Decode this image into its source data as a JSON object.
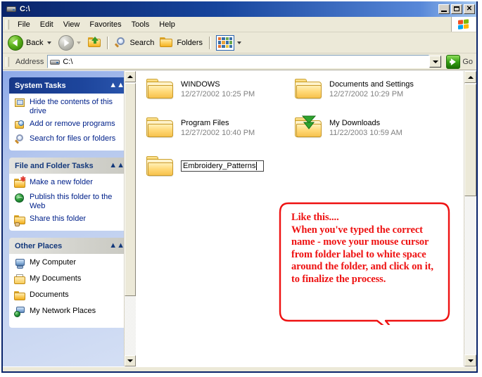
{
  "window": {
    "title": "C:\\",
    "title_icon": "hard-drive-icon",
    "minimize_label": "_",
    "maximize_label": "□",
    "close_label": "✕"
  },
  "menubar": {
    "items": [
      {
        "label": "File"
      },
      {
        "label": "Edit"
      },
      {
        "label": "View"
      },
      {
        "label": "Favorites"
      },
      {
        "label": "Tools"
      },
      {
        "label": "Help"
      }
    ],
    "brand_icon": "windows-flag-icon"
  },
  "toolbar": {
    "back_label": "Back",
    "back_icon": "back-arrow-icon",
    "forward_icon": "forward-arrow-icon",
    "up_icon": "up-one-level-icon",
    "search_label": "Search",
    "search_icon": "search-magnifier-icon",
    "folders_label": "Folders",
    "folders_icon": "folders-icon",
    "views_icon": "views-grid-icon"
  },
  "address": {
    "label": "Address",
    "value": "C:\\",
    "icon": "hard-drive-icon",
    "dropdown_icon": "chevron-down-icon",
    "go_label": "Go",
    "go_icon": "go-arrow-icon"
  },
  "sidebar": {
    "panels": [
      {
        "title": "System Tasks",
        "style": "navy",
        "collapse_icon": "chevron-up-icon",
        "items": [
          {
            "label": "Hide the contents of this drive",
            "icon": "hide-contents-icon"
          },
          {
            "label": "Add or remove programs",
            "icon": "add-remove-programs-icon"
          },
          {
            "label": "Search for files or folders",
            "icon": "search-files-icon"
          }
        ]
      },
      {
        "title": "File and Folder Tasks",
        "style": "gray",
        "collapse_icon": "chevron-up-icon",
        "items": [
          {
            "label": "Make a new folder",
            "icon": "new-folder-icon"
          },
          {
            "label": "Publish this folder to the Web",
            "icon": "publish-web-icon"
          },
          {
            "label": "Share this folder",
            "icon": "share-folder-icon"
          }
        ]
      },
      {
        "title": "Other Places",
        "style": "gray",
        "collapse_icon": "chevron-up-icon",
        "items": [
          {
            "label": "My Computer",
            "icon": "my-computer-icon"
          },
          {
            "label": "My Documents",
            "icon": "my-documents-icon"
          },
          {
            "label": "Documents",
            "icon": "folder-icon"
          },
          {
            "label": "My Network Places",
            "icon": "my-network-places-icon"
          }
        ]
      }
    ]
  },
  "files": [
    {
      "name": "WINDOWS",
      "date": "12/27/2002 10:25 PM",
      "icon": "folder-icon"
    },
    {
      "name": "Documents and Settings",
      "date": "12/27/2002 10:29 PM",
      "icon": "folder-icon"
    },
    {
      "name": "Program Files",
      "date": "12/27/2002 10:40 PM",
      "icon": "folder-icon"
    },
    {
      "name": "My Downloads",
      "date": "11/22/2003 10:59 AM",
      "icon": "folder-download-icon"
    }
  ],
  "rename": {
    "value": "Embroidery_Patterns",
    "icon": "folder-icon"
  },
  "callout": {
    "line1": "Like this....",
    "line2": "When you've typed the correct",
    "line3": "name - move your mouse cursor",
    "line4": "from folder label to white space",
    "line5": "around the folder, and click on it,",
    "line6": "to finalize the process.",
    "color": "#ee1111"
  },
  "colors": {
    "titlebar": "#0a246a",
    "panel_navy": "#173888",
    "link_blue": "#00218a",
    "date_gray": "#808080",
    "callout_red": "#ee1111",
    "chrome": "#ece9d8"
  }
}
